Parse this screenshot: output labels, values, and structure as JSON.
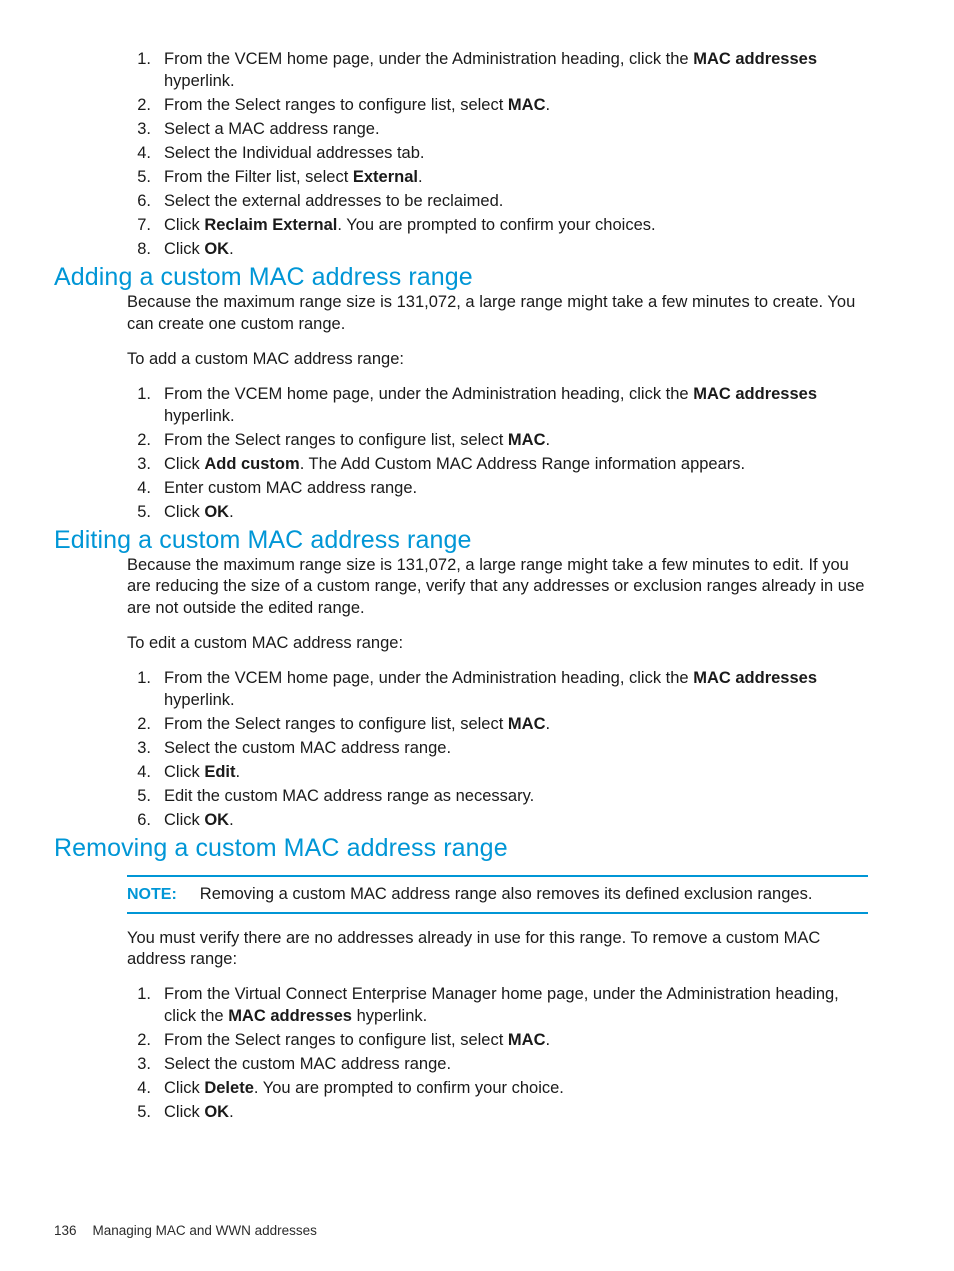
{
  "page": {
    "heading_color": "#0096D6",
    "text_color": "#1A1A1A",
    "background": "#FFFFFF"
  },
  "top_list": {
    "items": [
      {
        "num": "1.",
        "html": "From the VCEM home page, under the Administration heading, click the <b>MAC addresses</b> hyperlink."
      },
      {
        "num": "2.",
        "html": "From the Select ranges to configure list, select <b>MAC</b>."
      },
      {
        "num": "3.",
        "html": "Select a MAC address range."
      },
      {
        "num": "4.",
        "html": "Select the Individual addresses tab."
      },
      {
        "num": "5.",
        "html": "From the Filter list, select <b>External</b>."
      },
      {
        "num": "6.",
        "html": "Select the external addresses to be reclaimed."
      },
      {
        "num": "7.",
        "html": "Click <b>Reclaim External</b>. You are prompted to confirm your choices."
      },
      {
        "num": "8.",
        "html": "Click <b>OK</b>."
      }
    ]
  },
  "adding": {
    "heading": "Adding a custom MAC address range",
    "intro": "Because the maximum range size is 131,072, a large range might take a few minutes to create. You can create one custom range.",
    "lead_in": "To add a custom MAC address range:",
    "items": [
      {
        "num": "1.",
        "html": "From the VCEM home page, under the Administration heading, click the <b>MAC addresses</b> hyperlink."
      },
      {
        "num": "2.",
        "html": "From the Select ranges to configure list, select <b>MAC</b>."
      },
      {
        "num": "3.",
        "html": "Click <b>Add custom</b>. The Add Custom MAC Address Range information appears."
      },
      {
        "num": "4.",
        "html": "Enter custom MAC address range."
      },
      {
        "num": "5.",
        "html": "Click <b>OK</b>."
      }
    ]
  },
  "editing": {
    "heading": "Editing a custom MAC address range",
    "intro": "Because the maximum range size is 131,072, a large range might take a few minutes to edit. If you are reducing the size of a custom range, verify that any addresses or exclusion ranges already in use are not outside the edited range.",
    "lead_in": "To edit a custom MAC address range:",
    "items": [
      {
        "num": "1.",
        "html": "From the VCEM home page, under the Administration heading, click the <b>MAC addresses</b> hyperlink."
      },
      {
        "num": "2.",
        "html": "From the Select ranges to configure list, select <b>MAC</b>."
      },
      {
        "num": "3.",
        "html": "Select the custom MAC address range."
      },
      {
        "num": "4.",
        "html": "Click <b>Edit</b>."
      },
      {
        "num": "5.",
        "html": "Edit the custom MAC address range as necessary."
      },
      {
        "num": "6.",
        "html": "Click <b>OK</b>."
      }
    ]
  },
  "removing": {
    "heading": "Removing a custom MAC address range",
    "note_label": "NOTE:",
    "note_text": "Removing a custom MAC address range also removes its defined exclusion ranges.",
    "intro": "You must verify there are no addresses already in use for this range. To remove a custom MAC address range:",
    "items": [
      {
        "num": "1.",
        "html": "From the Virtual Connect Enterprise Manager home page, under the Administration heading, click the <b>MAC addresses</b> hyperlink."
      },
      {
        "num": "2.",
        "html": "From the Select ranges to configure list, select <b>MAC</b>."
      },
      {
        "num": "3.",
        "html": "Select the custom MAC address range."
      },
      {
        "num": "4.",
        "html": "Click <b>Delete</b>. You are prompted to confirm your choice."
      },
      {
        "num": "5.",
        "html": "Click <b>OK</b>."
      }
    ]
  },
  "footer": {
    "page_number": "136",
    "chapter_title": "Managing MAC and WWN addresses"
  }
}
